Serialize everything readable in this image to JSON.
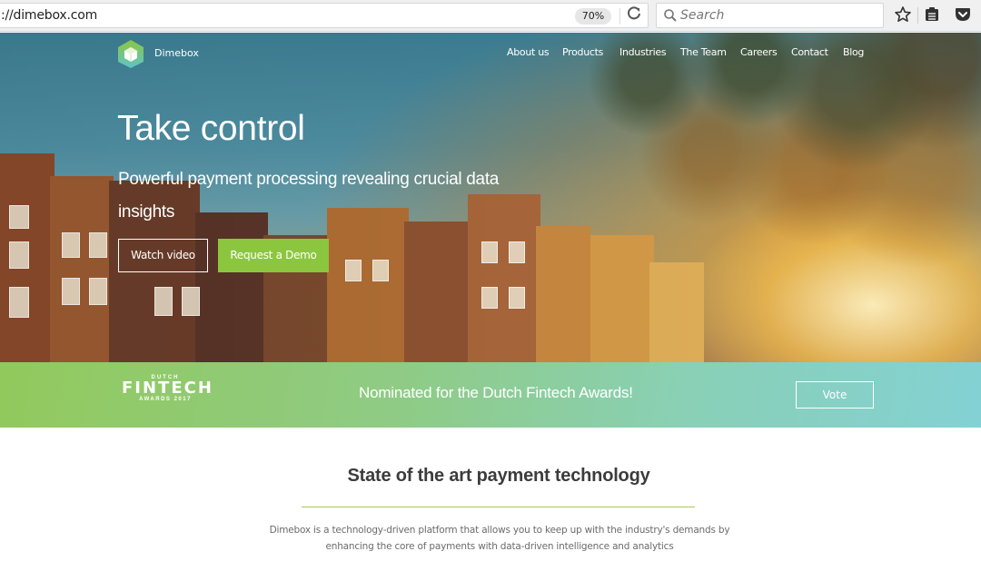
{
  "browser": {
    "url": "://dimebox.com",
    "zoom_level": "70%",
    "search_placeholder": "Search",
    "icons": {
      "reload": "reload-icon",
      "search": "search-icon",
      "bookmark": "star-icon",
      "reader": "reading-list-icon",
      "pocket": "pocket-icon"
    }
  },
  "site": {
    "brand": "Dimebox",
    "colors": {
      "accent": "#8cc63f",
      "rule": "#a7c957",
      "band_start": "#92c95c",
      "band_end": "#83d1d4"
    },
    "nav": [
      {
        "label": "About us"
      },
      {
        "label": "Products"
      },
      {
        "label": "Industries"
      },
      {
        "label": "The Team"
      },
      {
        "label": "Careers"
      },
      {
        "label": "Contact"
      },
      {
        "label": "Blog"
      }
    ]
  },
  "hero": {
    "headline": "Take control",
    "subhead": "Powerful payment processing revealing crucial data insights",
    "watch_video_label": "Watch video",
    "request_demo_label": "Request a Demo"
  },
  "awards": {
    "logo_top": "DUTCH",
    "logo_main": "FINTECH",
    "logo_bottom": "AWARDS 2017",
    "message": "Nominated for the Dutch Fintech Awards!",
    "vote_label": "Vote"
  },
  "content": {
    "title": "State of the art payment technology",
    "body": "Dimebox is a technology-driven platform that allows you to keep up with the industry's demands by enhancing the core of payments with data-driven intelligence and analytics"
  }
}
